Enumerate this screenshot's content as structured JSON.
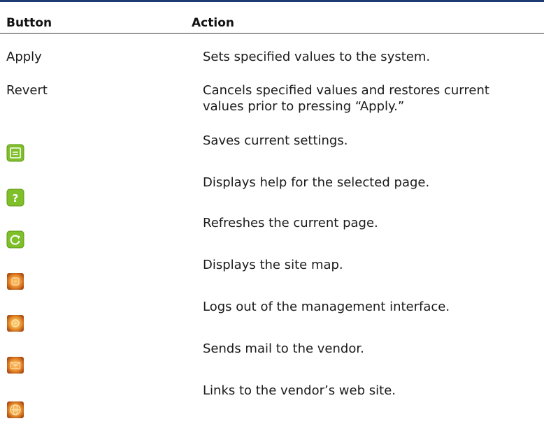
{
  "table": {
    "headers": {
      "button": "Button",
      "action": "Action"
    },
    "rows": [
      {
        "button_label": "Apply",
        "action": "Sets specified values to the system."
      },
      {
        "button_label": "Revert",
        "action": "Cancels specified values and restores current values prior to pressing “Apply.”"
      },
      {
        "icon": "save-icon",
        "action": "Saves current settings."
      },
      {
        "icon": "help-icon",
        "action": "Displays help for the selected page."
      },
      {
        "icon": "refresh-icon",
        "action": "Refreshes the current page."
      },
      {
        "icon": "site-map-icon",
        "action": "Displays the site map."
      },
      {
        "icon": "logout-icon",
        "action": "Logs out of the management interface."
      },
      {
        "icon": "mail-icon",
        "action": "Sends mail to the vendor."
      },
      {
        "icon": "web-site-icon",
        "action": "Links to the vendor’s web site."
      }
    ]
  },
  "colors": {
    "header_rule": "#1d3b73",
    "green_icon": "#7fbf2a",
    "orange_icon": "#e07a1e"
  }
}
